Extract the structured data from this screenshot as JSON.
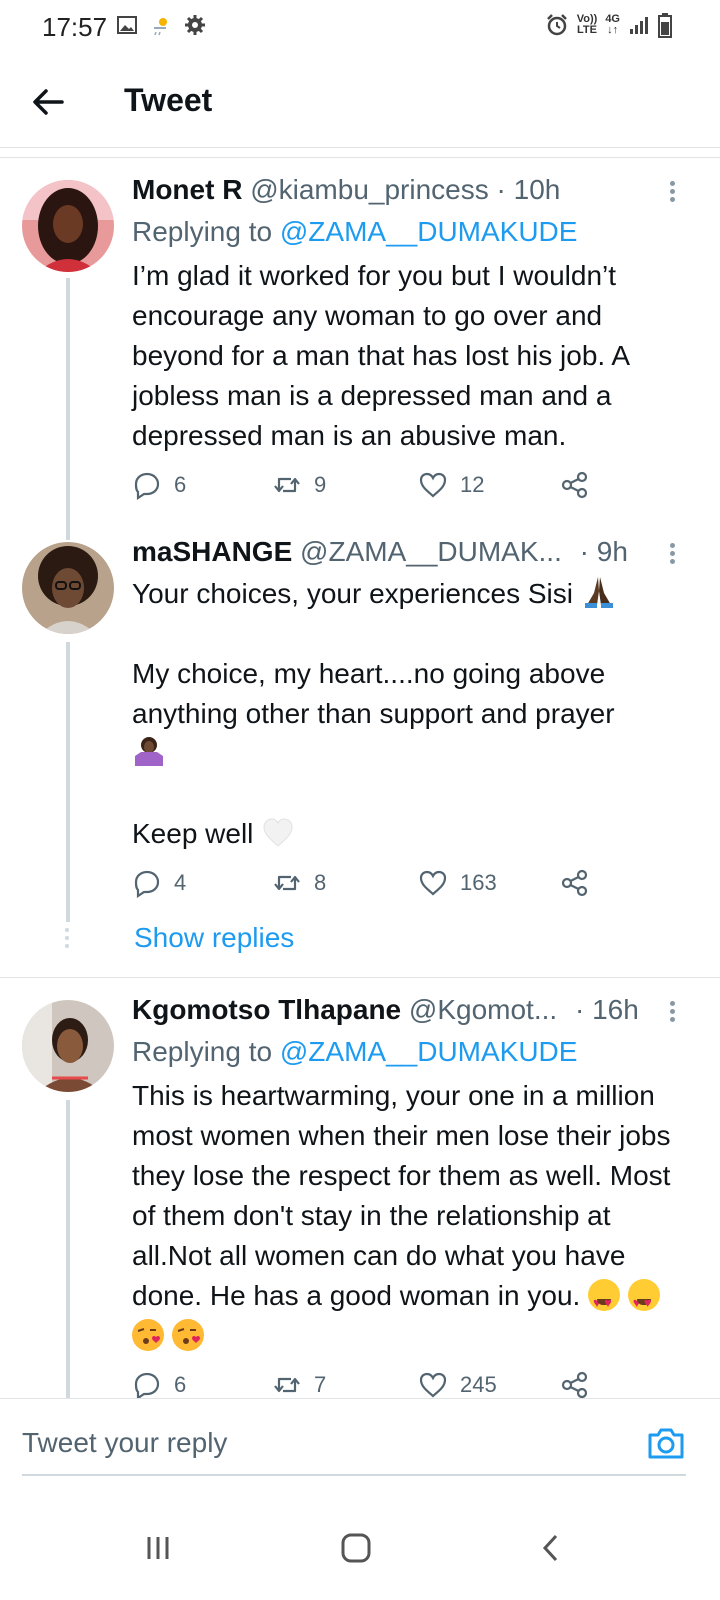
{
  "status_bar": {
    "time": "17:57",
    "left_icons": [
      "gallery-icon",
      "weather-icon",
      "settings-icon"
    ],
    "right_icons": [
      "alarm-icon",
      "volte-icon",
      "data-4g-icon",
      "signal-icon",
      "battery-icon"
    ],
    "volte_label_top": "Vo))",
    "volte_label_bottom": "LTE",
    "network_label": "4G"
  },
  "header": {
    "title": "Tweet"
  },
  "tweets": [
    {
      "name": "Monet R",
      "handle": "@kiambu_princess",
      "separator": "·",
      "time": "10h",
      "replying_prefix": "Replying to",
      "replying_to": "@ZAMA__DUMAKUDE",
      "text": "I’m glad it worked for you but I wouldn’t encourage any woman to go over and beyond for a man that has lost his job. A jobless man is a depressed man and a depressed man is an abusive man.",
      "replies": "6",
      "retweets": "9",
      "likes": "12"
    },
    {
      "name": "maSHANGE",
      "handle": "@ZAMA__DUMAK...",
      "separator": "·",
      "time": "9h",
      "text_line1": "Your choices, your experiences Sisi",
      "text_line2": "My choice, my heart....no going above anything other than support and prayer",
      "text_line3": "Keep well",
      "replies": "4",
      "retweets": "8",
      "likes": "163",
      "show_replies": "Show replies"
    },
    {
      "name": "Kgomotso Tlhapane",
      "handle": "@Kgomot...",
      "separator": "·",
      "time": "16h",
      "replying_prefix": "Replying to",
      "replying_to": "@ZAMA__DUMAKUDE",
      "text": "This is heartwarming, your one in a million most women when their men lose their jobs they lose the respect for them as well.  Most of them don't stay in the relationship at all.Not all women can do what you have done. He has a good woman in you.",
      "replies": "6",
      "retweets": "7",
      "likes": "245"
    }
  ],
  "compose": {
    "placeholder": "Tweet your reply"
  },
  "colors": {
    "accent": "#1d9bf0",
    "secondary_text": "#536471",
    "divider": "#e1e4e6"
  }
}
